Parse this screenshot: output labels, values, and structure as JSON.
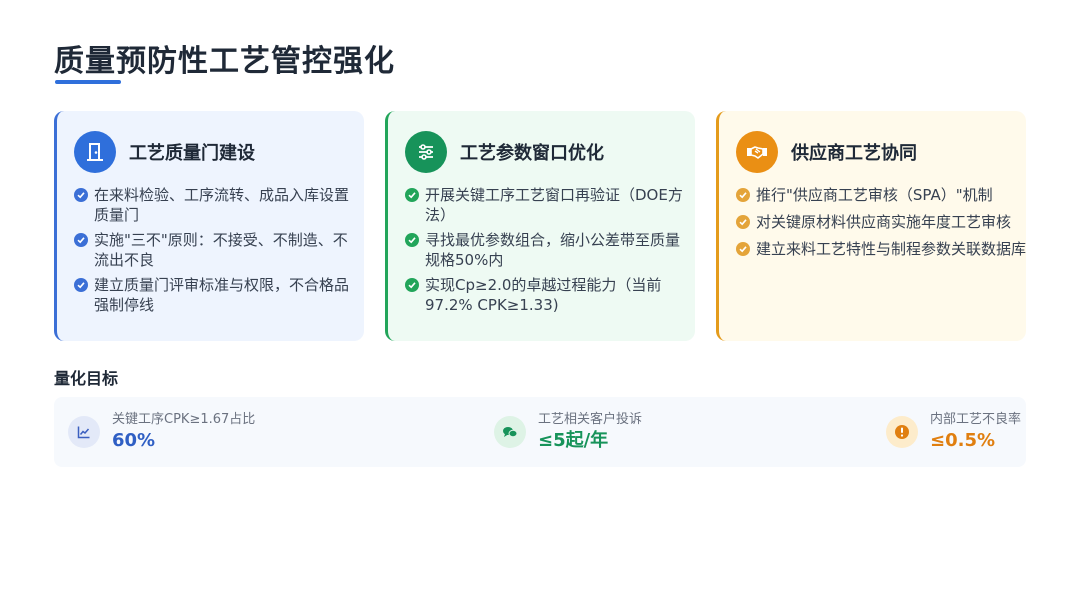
{
  "page": {
    "title": "质量预防性工艺管控强化"
  },
  "colors": {
    "blue": "#2f6fdb",
    "green": "#17935a",
    "amber": "#ea8f14"
  },
  "cards": [
    {
      "title": "工艺质量门建设",
      "icon": "door-icon",
      "items": [
        "在来料检验、工序流转、成品入库设置质量门",
        "实施\"三不\"原则：不接受、不制造、不流出不良",
        "建立质量门评审标准与权限，不合格品强制停线"
      ]
    },
    {
      "title": "工艺参数窗口优化",
      "icon": "sliders-icon",
      "items": [
        "开展关键工序工艺窗口再验证（DOE方法）",
        "寻找最优参数组合，缩小公差带至质量规格50%内",
        "实现Cp≥2.0的卓越过程能力（当前97.2% CPK≥1.33)"
      ]
    },
    {
      "title": "供应商工艺协同",
      "icon": "handshake-icon",
      "items": [
        "推行\"供应商工艺审核（SPA）\"机制",
        "对关键原材料供应商实施年度工艺审核",
        "建立来料工艺特性与制程参数关联数据库"
      ]
    }
  ],
  "targets": {
    "label": "量化目标",
    "metrics": [
      {
        "label": "关键工序CPK≥1.67占比",
        "value": "60%",
        "icon": "line-chart-icon"
      },
      {
        "label": "工艺相关客户投诉",
        "value": "≤5起/年",
        "icon": "chat-icon"
      },
      {
        "label": "内部工艺不良率",
        "value": "≤0.5%",
        "icon": "alert-icon"
      }
    ]
  }
}
